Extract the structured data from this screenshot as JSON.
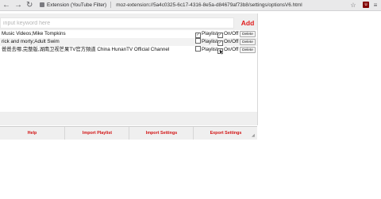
{
  "browser": {
    "back_glyph": "←",
    "forward_glyph": "→",
    "reload_glyph": "↻",
    "tab_title": "Extension (YouTube Filter)",
    "url": "moz-extension://5a4c0325-6c17-4316-8e5a-d84679af73b8/settings/optionsV6.html",
    "bookmark_glyph": "☆",
    "ublock_label": "u",
    "menu_glyph": "≡"
  },
  "search": {
    "placeholder": "input keyword here",
    "value": "",
    "add_label": "Add"
  },
  "filters": [
    {
      "name": "Music Videos;Mike Tompkins",
      "playlist_checked": true,
      "onoff_checked": true
    },
    {
      "name": "rick and morty;Adult Swim",
      "playlist_checked": false,
      "onoff_checked": true
    },
    {
      "name": "爸爸去哪,完整版,湖南卫视芒果TV官方頻道 China HunanTV Official Channel",
      "playlist_checked": false,
      "onoff_checked": true
    }
  ],
  "row_labels": {
    "playlist": "Playlist",
    "onoff": "On/Off",
    "delete": "Delete",
    "check_glyph": "✓"
  },
  "footer": {
    "help": "Help",
    "import_playlist": "Import Playlist",
    "import_settings": "Import Settings",
    "export_settings": "Export Settings"
  },
  "colors": {
    "accent_red": "#e01b1b",
    "panel_bg": "#efefef"
  }
}
